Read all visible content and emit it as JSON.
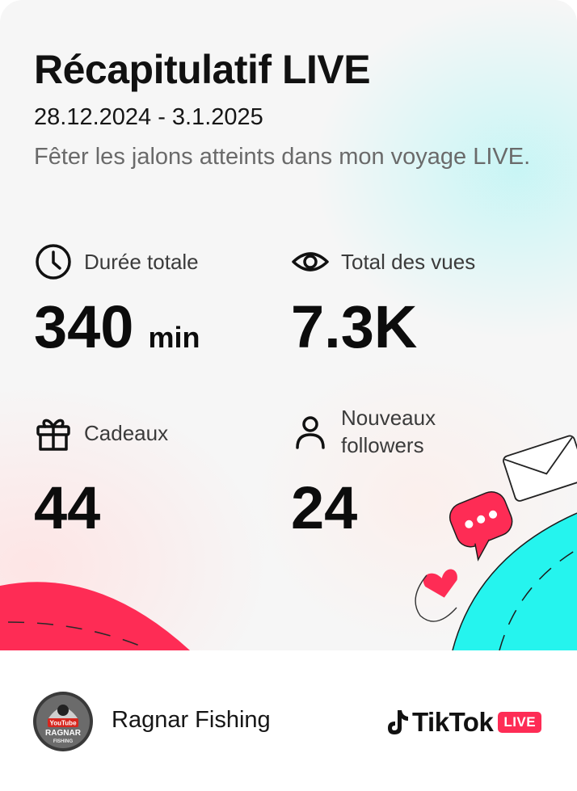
{
  "header": {
    "title": "Récapitulatif LIVE",
    "date_range": "28.12.2024 - 3.1.2025",
    "subtitle": "Fêter les jalons atteints dans mon voyage LIVE."
  },
  "stats": {
    "duration": {
      "icon": "clock-icon",
      "label": "Durée totale",
      "value": "340",
      "unit": "min"
    },
    "views": {
      "icon": "eye-icon",
      "label": "Total des vues",
      "value": "7.3K"
    },
    "gifts": {
      "icon": "gift-icon",
      "label": "Cadeaux",
      "value": "44"
    },
    "followers": {
      "icon": "person-icon",
      "label": "Nouveaux followers",
      "value": "24"
    }
  },
  "footer": {
    "channel_name": "Ragnar Fishing",
    "avatar_text": {
      "line1": "YouTube",
      "line2": "RAGNAR",
      "line3": "FISHING"
    },
    "brand": {
      "name": "TikTok",
      "badge": "LIVE"
    }
  },
  "colors": {
    "accent_red": "#fe2c55",
    "accent_cyan": "#25f4ee"
  }
}
